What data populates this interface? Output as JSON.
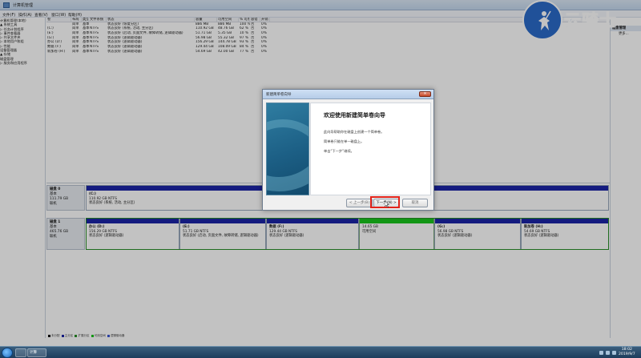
{
  "window": {
    "title": "计算机管理"
  },
  "menubar": [
    "文件(F)",
    "操作(A)",
    "查看(V)",
    "窗口(W)",
    "帮助(H)"
  ],
  "tree": [
    "计算机管理(本地)",
    "▲ 系统工具",
    "  ▷ 任务计划程序",
    "  ▷ 事件查看器",
    "  ▷ 共享文件夹",
    "  ▷ 本地用户和组",
    "  ▷ 性能",
    "    设备管理器",
    "▲ 存储",
    "    磁盘管理",
    "▷ 服务和应用程序"
  ],
  "volume_table": {
    "headers": [
      "卷",
      "布局",
      "类型",
      "文件系统",
      "状态",
      "容量",
      "可用空间",
      "% 可用",
      "容错",
      "开销"
    ],
    "rows": [
      [
        "",
        "简单",
        "基本",
        "",
        "状态良好 (恢复分区)",
        "886 MB",
        "886 MB",
        "100 %",
        "否",
        "0%"
      ],
      [
        "(C:)",
        "简单",
        "基本",
        "NTFS",
        "状态良好 (系统, 活动, 主分区)",
        "110.92 GB",
        "48.76 GB",
        "62 %",
        "否",
        "0%"
      ],
      [
        "(E:)",
        "简单",
        "基本",
        "NTFS",
        "状态良好 (启动, 页面文件, 故障转储, 逻辑驱动器)",
        "51.71 GB",
        "5.35 GB",
        "10 %",
        "否",
        "0%"
      ],
      [
        "(G:)",
        "简单",
        "基本",
        "NTFS",
        "状态良好 (逻辑驱动器)",
        "56.98 GB",
        "55.32 GB",
        "97 %",
        "否",
        "0%"
      ],
      [
        "办公 (D:)",
        "简单",
        "基本",
        "NTFS",
        "状态良好 (逻辑驱动器)",
        "156.29 GB",
        "144.78 GB",
        "93 %",
        "否",
        "0%"
      ],
      [
        "数据 (F:)",
        "简单",
        "基本",
        "NTFS",
        "状态良好 (逻辑驱动器)",
        "129.44 GB",
        "108.09 GB",
        "84 %",
        "否",
        "0%"
      ],
      [
        "新加卷 (H:)",
        "简单",
        "基本",
        "NTFS",
        "状态良好 (逻辑驱动器)",
        "54.69 GB",
        "42.00 GB",
        "77 %",
        "否",
        "0%"
      ]
    ]
  },
  "disk0": {
    "name": "磁盘 0",
    "type": "基本",
    "size": "111.79 GB",
    "status": "联机",
    "partitions": [
      {
        "name": "(C:)",
        "size": "110.92 GB NTFS",
        "status": "状态良好 (系统, 活动, 主分区)"
      }
    ]
  },
  "disk1": {
    "name": "磁盘 1",
    "type": "基本",
    "size": "465.76 GB",
    "status": "联机",
    "partitions": [
      {
        "name": "办公 (D:)",
        "size": "156.29 GB NTFS",
        "status": "状态良好 (逻辑驱动器)"
      },
      {
        "name": "(E:)",
        "size": "51.71 GB NTFS",
        "status": "状态良好 (启动, 页面文件, 故障转储, 逻辑驱动器)"
      },
      {
        "name": "数据 (F:)",
        "size": "129.44 GB NTFS",
        "status": "状态良好 (逻辑驱动器)"
      },
      {
        "name": "",
        "size": "14.65 GB",
        "status": "可用空间"
      },
      {
        "name": "(G:)",
        "size": "56.98 GB NTFS",
        "status": "状态良好 (逻辑驱动器)"
      },
      {
        "name": "新加卷 (H:)",
        "size": "54.69 GB NTFS",
        "status": "状态良好 (逻辑驱动器)"
      }
    ]
  },
  "legend": [
    "未分配",
    "主分区",
    "扩展分区",
    "可用空间",
    "逻辑驱动器"
  ],
  "actions": {
    "title": "磁盘管理",
    "more": "更多..."
  },
  "logo": {
    "text": "云骑士"
  },
  "dialog": {
    "title": "新建简单卷向导",
    "heading": "欢迎使用新建简单卷向导",
    "lines": [
      "此向导帮助你在磁盘上创建一个简单卷。",
      "简单卷只能在单一磁盘上。",
      "单击“下一步”继续。"
    ],
    "back": "< 上一步(B)",
    "next": "下一步(N) >",
    "cancel": "取消"
  },
  "taskbar": {
    "label": "计算",
    "time": "18:02",
    "date": "2019/9/7"
  }
}
